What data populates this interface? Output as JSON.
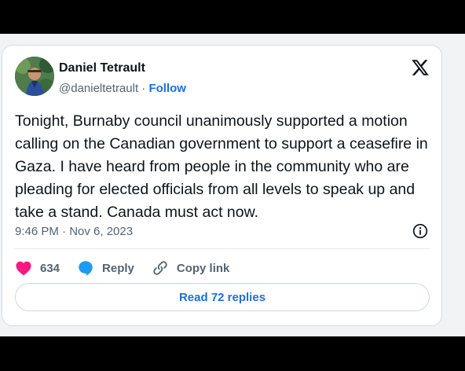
{
  "tweet": {
    "author_name": "Daniel Tetrault",
    "handle": "@danieltetrault",
    "separator": "·",
    "follow_label": "Follow",
    "text": "Tonight, Burnaby council unanimously supported a motion calling on the Canadian government to support a ceasefire in Gaza. I have heard from people in the community who are pleading for elected officials from all levels to speak up and take a stand. Canada must act now.",
    "timestamp": "9:46 PM · Nov 6, 2023"
  },
  "actions": {
    "likes_count": "634",
    "reply_label": "Reply",
    "copy_link_label": "Copy link"
  },
  "replies_button_label": "Read 72 replies",
  "icons": {
    "brand": "x-logo-icon",
    "info": "info-icon",
    "like": "heart-icon",
    "reply": "reply-bubble-icon",
    "copy": "link-icon"
  },
  "colors": {
    "accent": "#1d6fd8",
    "like": "#f91880",
    "reply": "#1d9bf0",
    "text": "#0f1419",
    "muted": "#536471"
  }
}
